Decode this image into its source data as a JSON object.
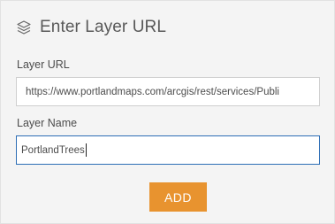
{
  "header": {
    "icon": "layers-icon",
    "title": "Enter Layer URL"
  },
  "form": {
    "url_label": "Layer URL",
    "url_value": "https://www.portlandmaps.com/arcgis/rest/services/Publi",
    "name_label": "Layer Name",
    "name_value": "PortlandTrees",
    "add_label": "ADD"
  },
  "colors": {
    "accent": "#e8932f",
    "focus_border": "#2d6eb5",
    "panel_bg": "#f4f4f4"
  }
}
